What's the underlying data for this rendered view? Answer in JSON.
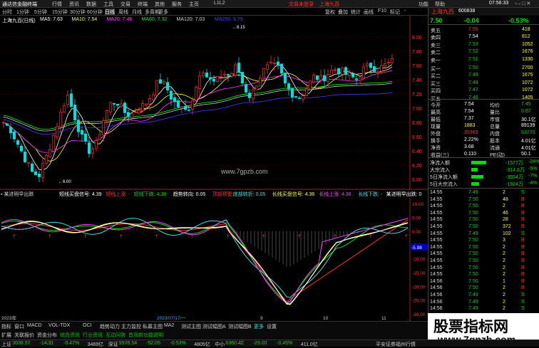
{
  "menu": {
    "title": "通达信金融终端",
    "items": [
      "行情",
      "资讯",
      "数据",
      "工具",
      "交易",
      "终端",
      "其他",
      "服务",
      "主页",
      "L1L2"
    ],
    "ticker": "交易未登录",
    "ticker2": "上海九百",
    "right": [
      "功能",
      "帮助"
    ],
    "time": "07:56:33"
  },
  "timeframes": {
    "items": [
      "分时",
      "1分钟",
      "5分钟",
      "15分钟",
      "30分钟",
      "60分钟",
      "日线",
      "周线",
      "月线",
      "多周期",
      "更多"
    ],
    "active": "日线",
    "right": [
      "复权",
      "叠加",
      "统计",
      "画线",
      "F10",
      "标记",
      "-"
    ]
  },
  "main_chart": {
    "stock_title": "上海九百(日线)",
    "ma_labels": [
      {
        "text": "MA5: 7.63",
        "color": "#ffffff"
      },
      {
        "text": "MA10: 7.54",
        "color": "#ffff40"
      },
      {
        "text": "MA20: 7.46",
        "color": "#ff40ff"
      },
      {
        "text": "MA60: 7.32",
        "color": "#00ff00"
      },
      {
        "text": "MA120: 7.03",
        "color": "#d0d0d0"
      },
      {
        "text": "MA250: 6.79",
        "color": "#4040ff"
      }
    ],
    "y_ticks": [
      "8.00",
      "7.80",
      "7.60",
      "7.40",
      "7.20",
      "7.00",
      "6.80",
      "6.60",
      "6.40",
      "6.20",
      "6.00"
    ],
    "high_label": "8.15",
    "low_label": "6.00",
    "watermark": "www.7gpzb.com"
  },
  "indicator": {
    "name": "某进明早出跌",
    "items": [
      {
        "text": "短线买盘信号: 4.39",
        "color": "#ffffff"
      },
      {
        "text": "短线上涨: -",
        "color": "#ff3030"
      },
      {
        "text": "短线下跌: 4.39",
        "color": "#00e000"
      },
      {
        "text": "趋势转向: 0.05",
        "color": "#ffffff"
      },
      {
        "text": "顶部预警:",
        "color": "#ff3030"
      },
      {
        "text": "底部转折: 0.05",
        "color": "#40e0e0"
      },
      {
        "text": "长线买盘信号: 4.36",
        "color": "#ffff40"
      },
      {
        "text": "长线上涨: 4.36",
        "color": "#ff40ff"
      },
      {
        "text": "长线下跌: -",
        "color": "#40e0e0"
      },
      {
        "text": "某进明早出跌: 0",
        "color": "#ffffff"
      }
    ],
    "y_ticks": [
      "10.00",
      "5.00",
      "0.00",
      "-5.00",
      "-10.00",
      "-15.00",
      "-20.00",
      "-25.00",
      "-30.00"
    ],
    "last_value": "-5.98"
  },
  "date_axis": {
    "labels": [
      "2023年",
      "2023/07/17/一",
      "9",
      "10",
      "11"
    ]
  },
  "bottom_tabs": {
    "row1": [
      "指标",
      "窗口",
      "MACD",
      "VOL-TDX",
      "OCI",
      "趋势动力",
      "主力监控",
      "私募主图",
      "MA2",
      "测试主图",
      "测试幅图A",
      "测试幅图B",
      "更多",
      "设置"
    ],
    "row2": [
      "扩展",
      "关联报价",
      "资金分布",
      "综合资讯",
      "行业资讯",
      "互动问答",
      "首页新功能说明"
    ]
  },
  "quote": {
    "name": "上海九百",
    "code": "600838",
    "price": "7.50",
    "change": "-0.04",
    "pct": "-0.53%",
    "sells": [
      {
        "label": "卖五",
        "price": "7.55",
        "vol": "418"
      },
      {
        "label": "卖四",
        "price": "7.54",
        "vol": "812"
      },
      {
        "label": "卖三",
        "price": "7.53",
        "vol": "1052"
      },
      {
        "label": "卖二",
        "price": "7.52",
        "vol": "1676"
      },
      {
        "label": "卖一",
        "price": "7.51",
        "vol": "1330"
      }
    ],
    "buys": [
      {
        "label": "买一",
        "price": "7.50",
        "vol": "2700"
      },
      {
        "label": "买二",
        "price": "7.49",
        "vol": "1675"
      },
      {
        "label": "买三",
        "price": "7.48",
        "vol": "1072"
      },
      {
        "label": "买四",
        "price": "7.47",
        "vol": "1072"
      },
      {
        "label": "买五",
        "price": "7.46",
        "vol": "1405"
      }
    ],
    "stats": [
      {
        "l1": "今开",
        "v1": "7.54",
        "l2": "均价",
        "v2": "7.45"
      },
      {
        "l1": "最高",
        "v1": "7.54",
        "l2": "量比",
        "v2": "0.67"
      },
      {
        "l1": "最低",
        "v1": "7.37",
        "l2": "市值",
        "v2": "30.1亿"
      },
      {
        "l1": "现量",
        "v1": "1883",
        "l2": "总量",
        "v2": "89139"
      },
      {
        "l1": "外盘",
        "v1": "35369",
        "l2": "内盘",
        "v2": "53770"
      },
      {
        "l1": "换手",
        "v1": "2.22%",
        "l2": "股本",
        "v2": "4.01亿"
      },
      {
        "l1": "净资",
        "v1": "3.68",
        "l2": "流通",
        "v2": "4.01亿"
      },
      {
        "l1": "收益(三)",
        "v1": "0.110",
        "l2": "PE(动)",
        "v2": "50.1"
      }
    ],
    "flows": [
      {
        "label": "净流入额",
        "val": "-1577万",
        "pct": "-24%",
        "color": "#00e000",
        "ratio": 0.4
      },
      {
        "label": "大宗流入",
        "val": "-314.8万",
        "pct": "-5%",
        "color": "#00e000",
        "ratio": 0.1
      },
      {
        "label": "5日净流入额",
        "val": "-3554万",
        "pct": "-7%",
        "color": "#00e000",
        "ratio": 0.3
      },
      {
        "label": "5日大宗流入",
        "val": "-1924万",
        "pct": "-4%",
        "color": "#00e000",
        "ratio": 0.15
      }
    ],
    "ticks": [
      [
        "14:55",
        "7.49",
        "2",
        "S"
      ],
      [
        "14:55",
        "7.50",
        "48",
        "B"
      ],
      [
        "14:55",
        "7.50",
        "2",
        "B"
      ],
      [
        "14:55",
        "7.50",
        "46",
        "B"
      ],
      [
        "14:55",
        "7.50",
        "28",
        "B"
      ],
      [
        "14:55",
        "7.50",
        "372",
        "B"
      ],
      [
        "14:55",
        "7.49",
        "102",
        "S"
      ],
      [
        "14:55",
        "7.50",
        "3",
        "B"
      ],
      [
        "14:55",
        "7.50",
        "2",
        "B"
      ],
      [
        "14:55",
        "7.50",
        "2",
        "B"
      ],
      [
        "14:55",
        "7.50",
        "2",
        "B"
      ],
      [
        "14:55",
        "7.50",
        "2",
        "B"
      ],
      [
        "14:55",
        "7.50",
        "2",
        "B"
      ],
      [
        "14:56",
        "7.50",
        "1",
        "B"
      ],
      [
        "14:56",
        "7.50",
        "2",
        "B"
      ],
      [
        "14:56",
        "7.49",
        "2",
        "S"
      ],
      [
        "14:56",
        "7.49",
        "2",
        "S"
      ],
      [
        "14:56",
        "7.49",
        "2",
        "S"
      ],
      [
        "14:56",
        "7.49",
        "2",
        "S"
      ],
      [
        "14:56",
        "7.49",
        "2",
        "S"
      ],
      [
        "14:56",
        "7.49",
        "2",
        "S"
      ],
      [
        "14:56",
        "7.49",
        "2",
        "S"
      ]
    ]
  },
  "watermark_box": {
    "big": "股票指标网",
    "small": "www.7gpzb.com"
  },
  "status": {
    "items": [
      {
        "text": "上证",
        "color": "#ccc"
      },
      {
        "text": "3038.97",
        "color": "#00e000"
      },
      {
        "text": "-14.31",
        "color": "#00e000"
      },
      {
        "text": "-0.47%",
        "color": "#00e000"
      },
      {
        "text": "3469亿",
        "color": "#ccc"
      },
      {
        "text": "深证",
        "color": "#ccc"
      },
      {
        "text": "9978.54",
        "color": "#00e000"
      },
      {
        "text": "-52.05",
        "color": "#00e000"
      },
      {
        "text": "-0.53%",
        "color": "#00e000"
      },
      {
        "text": "4805亿",
        "color": "#ccc"
      },
      {
        "text": "中小",
        "color": "#ccc"
      },
      {
        "text": "6360.42",
        "color": "#00e000"
      },
      {
        "text": "-29.00",
        "color": "#00e000"
      },
      {
        "text": "-0.45%",
        "color": "#00e000"
      },
      {
        "text": "411.0亿",
        "color": "#ccc"
      }
    ],
    "right": "平安证券福州行情"
  }
}
